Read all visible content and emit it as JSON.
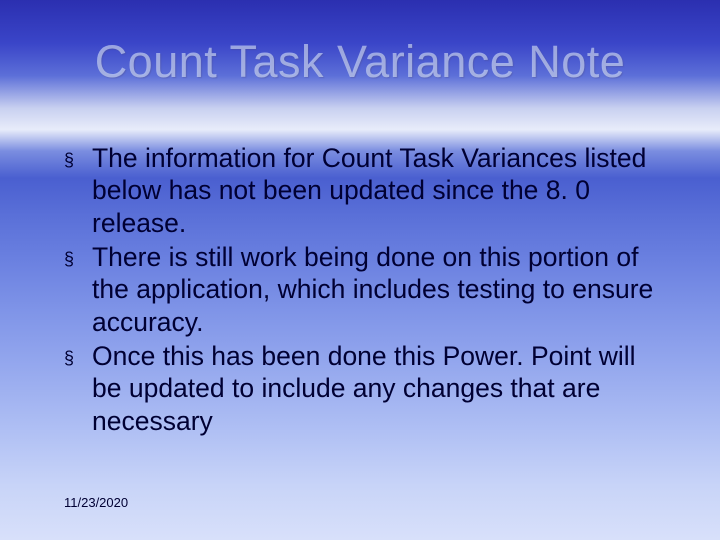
{
  "slide": {
    "title": "Count Task Variance Note",
    "bullet_glyph": "§",
    "bullets": [
      "The information for Count Task Variances listed below has not been updated since the 8. 0 release.",
      "There is still work being done on this portion of the application, which includes testing to ensure accuracy.",
      "Once this has been done this Power. Point will be updated to include any changes that are necessary"
    ],
    "footer_date": "11/23/2020"
  }
}
